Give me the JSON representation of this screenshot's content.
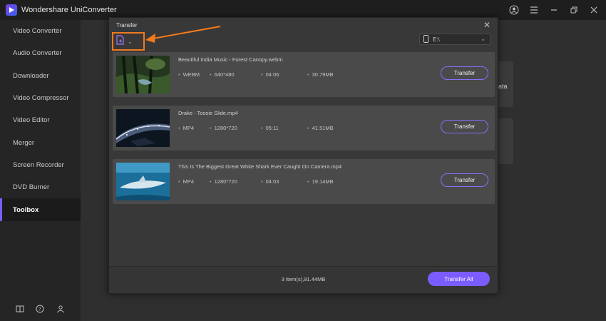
{
  "app": {
    "title": "Wondershare UniConverter"
  },
  "sidebar": {
    "items": [
      {
        "label": "Video Converter"
      },
      {
        "label": "Audio Converter"
      },
      {
        "label": "Downloader"
      },
      {
        "label": "Video Compressor"
      },
      {
        "label": "Video Editor"
      },
      {
        "label": "Merger"
      },
      {
        "label": "Screen Recorder"
      },
      {
        "label": "DVD Burner"
      },
      {
        "label": "Toolbox"
      }
    ],
    "active_index": 8
  },
  "background": {
    "card_text": "ata"
  },
  "dialog": {
    "title": "Transfer",
    "device": "E:\\",
    "files": [
      {
        "name": "Beautiful India Music - Forest Canopy.webm",
        "format": "WEBM",
        "resolution": "640*480",
        "duration": "04:06",
        "size": "30.79MB",
        "button": "Transfer"
      },
      {
        "name": "Drake - Toosie Slide.mp4",
        "format": "MP4",
        "resolution": "1280*720",
        "duration": "05:11",
        "size": "41.51MB",
        "button": "Transfer"
      },
      {
        "name": "This Is The Biggest Great White Shark Ever Caught On Camera.mp4",
        "format": "MP4",
        "resolution": "1280*720",
        "duration": "04:03",
        "size": "19.14MB",
        "button": "Transfer"
      }
    ],
    "footer": {
      "total": "3 Item(s),91.44MB",
      "transfer_all": "Transfer All"
    }
  },
  "colors": {
    "accent": "#7b5cff",
    "highlight": "#f07a1e",
    "dialog_bg": "#383838",
    "row_bg": "#4a4a4a"
  },
  "icons": [
    "add-file-icon",
    "chevron-down-icon",
    "phone-icon",
    "close-icon",
    "user-icon",
    "menu-icon",
    "minimize-icon",
    "maximize-icon",
    "book-icon",
    "help-icon",
    "account-icon"
  ]
}
